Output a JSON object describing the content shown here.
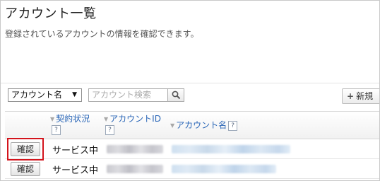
{
  "page": {
    "title": "アカウント一覧",
    "description": "登録されているアカウントの情報を確認できます。"
  },
  "toolbar": {
    "filter_select": {
      "selected": "アカウント名",
      "icon": "chevron-down-icon"
    },
    "search": {
      "placeholder": "アカウント検索",
      "button_icon": "search-icon"
    },
    "new_button_label": "新規"
  },
  "table": {
    "columns": [
      {
        "label": "契約状況",
        "help": "?"
      },
      {
        "label": "アカウントID",
        "help": "?"
      },
      {
        "label": "アカウント名",
        "help": "?"
      }
    ],
    "rows": [
      {
        "action": "確認",
        "status": "サービス中",
        "highlighted": true
      },
      {
        "action": "確認",
        "status": "サービス中",
        "highlighted": false
      }
    ]
  },
  "colors": {
    "highlight": "#d3141c",
    "header_link": "#2a66b7"
  }
}
